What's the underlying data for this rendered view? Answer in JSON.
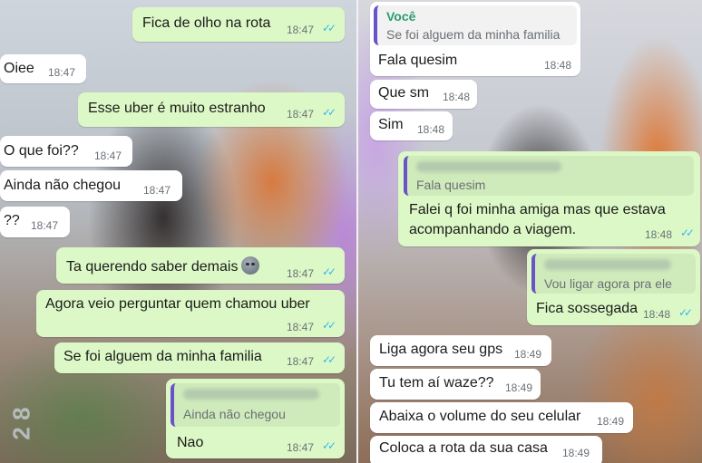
{
  "left": {
    "messages": [
      {
        "dir": "out",
        "text": "Fica de olho na rota",
        "time": "18:47"
      },
      {
        "dir": "in",
        "text": "Oiee",
        "time": "18:47"
      },
      {
        "dir": "out",
        "text": "Esse uber é muito estranho",
        "time": "18:47"
      },
      {
        "dir": "in",
        "text": "O que foi??",
        "time": "18:47"
      },
      {
        "dir": "in",
        "text": "Ainda não chegou",
        "time": "18:47"
      },
      {
        "dir": "in",
        "text": "??",
        "time": "18:47"
      },
      {
        "dir": "out",
        "text": "Ta querendo saber demais",
        "time": "18:47",
        "emoji": "neutral-face-icon"
      },
      {
        "dir": "out",
        "text": "Agora veio perguntar quem chamou uber",
        "time": "18:47"
      },
      {
        "dir": "out",
        "text": "Se foi alguem da minha familia",
        "time": "18:47"
      },
      {
        "dir": "out",
        "text": "Nao",
        "time": "18:47",
        "quote": {
          "text": "Ainda não chegou"
        }
      }
    ],
    "watermark": "2 8"
  },
  "right": {
    "messages": [
      {
        "dir": "in",
        "text": "Fala quesim",
        "time": "18:48",
        "quote": {
          "sender": "Você",
          "text": "Se foi alguem da minha familia"
        }
      },
      {
        "dir": "in",
        "text": "Que sm",
        "time": "18:48"
      },
      {
        "dir": "in",
        "text": "Sim",
        "time": "18:48"
      },
      {
        "dir": "out",
        "text": "Falei q foi minha amiga  mas que estava",
        "text2": "acompanhando a viagem.",
        "time": "18:48",
        "quote": {
          "text": "Fala quesim"
        }
      },
      {
        "dir": "out",
        "text": "Fica sossegada",
        "time": "18:48",
        "quote": {
          "text": "Vou ligar agora pra ele"
        }
      },
      {
        "dir": "in",
        "text": "Liga agora seu gps",
        "time": "18:49"
      },
      {
        "dir": "in",
        "text": "Tu tem aí waze??",
        "time": "18:49"
      },
      {
        "dir": "in",
        "text": "Abaixa o volume do seu celular",
        "time": "18:49"
      },
      {
        "dir": "in",
        "text": "Coloca a rota da sua casa",
        "time": "18:49"
      }
    ]
  },
  "colors": {
    "incoming": "#ffffff",
    "outgoing": "#dcf8c6",
    "read_ticks": "#34b7f1",
    "quote_bar": "#6a52c8",
    "quote_sender": "#2a9d6f"
  }
}
